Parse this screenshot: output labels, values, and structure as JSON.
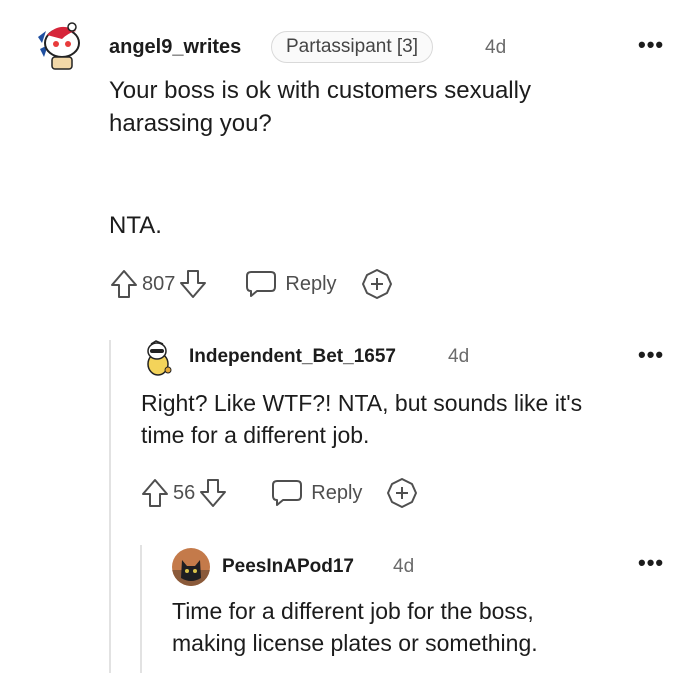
{
  "comments": [
    {
      "username": "angel9_writes",
      "flair": "Partassipant [3]",
      "time": "4d",
      "more": "•••",
      "body": [
        "Your boss is ok with customers sexually",
        "harassing you?",
        "",
        "",
        "NTA."
      ],
      "votes": "807",
      "reply_label": "Reply"
    },
    {
      "username": "Independent_Bet_1657",
      "time": "4d",
      "more": "•••",
      "body": [
        "Right? Like WTF?! NTA, but sounds like it's",
        "time for a different job."
      ],
      "votes": "56",
      "reply_label": "Reply"
    },
    {
      "username": "PeesInAPod17",
      "time": "4d",
      "more": "•••",
      "body": [
        "Time for a different job for the boss,",
        "making license plates or something."
      ]
    }
  ]
}
